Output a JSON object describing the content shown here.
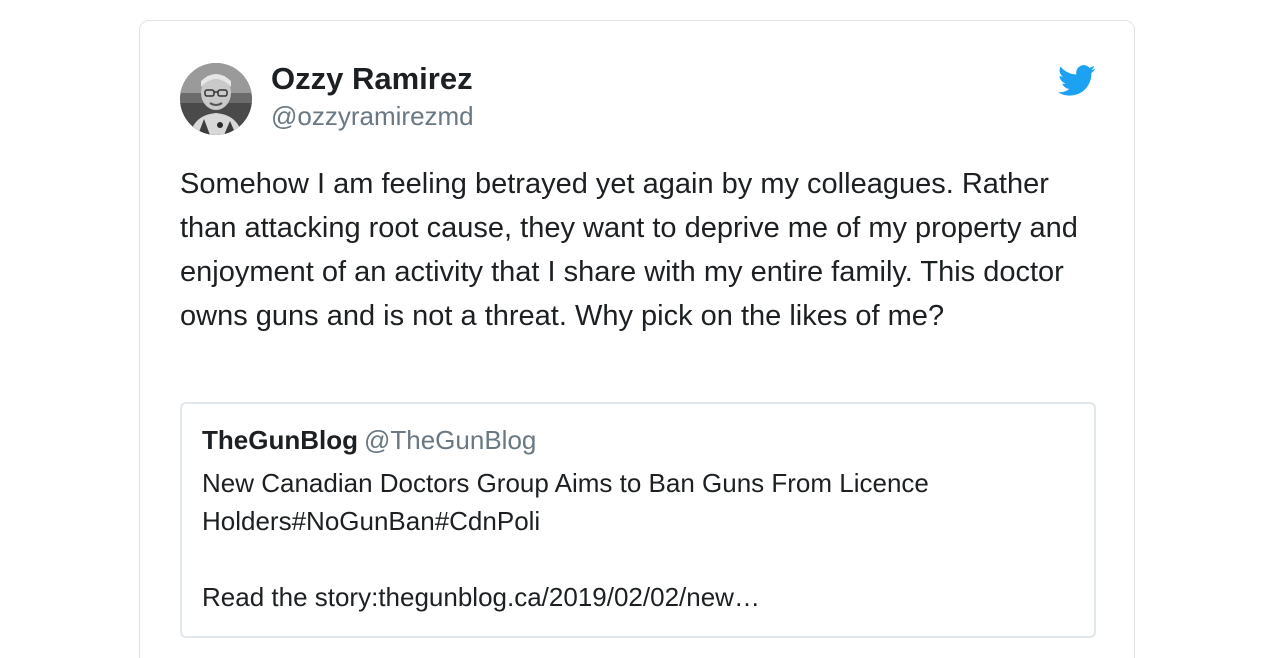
{
  "tweet": {
    "author": {
      "name": "Ozzy Ramirez",
      "handle": "@ozzyramirezmd"
    },
    "text": "Somehow I am feeling betrayed yet again by my colleagues. Rather than attacking root cause, they want to deprive me of my property and enjoyment of an activity that I share with my entire family. This doctor owns guns and is not a threat. Why pick on the likes of me?",
    "brand_icon": "twitter-bird-icon",
    "brand_color": "#1da1f2",
    "quoted": {
      "name": "TheGunBlog",
      "handle": "@TheGunBlog",
      "text": "New Canadian Doctors Group Aims to Ban Guns From Licence Holders#NoGunBan#CdnPoli\n\nRead the story:thegunblog.ca/2019/02/02/new…"
    }
  }
}
